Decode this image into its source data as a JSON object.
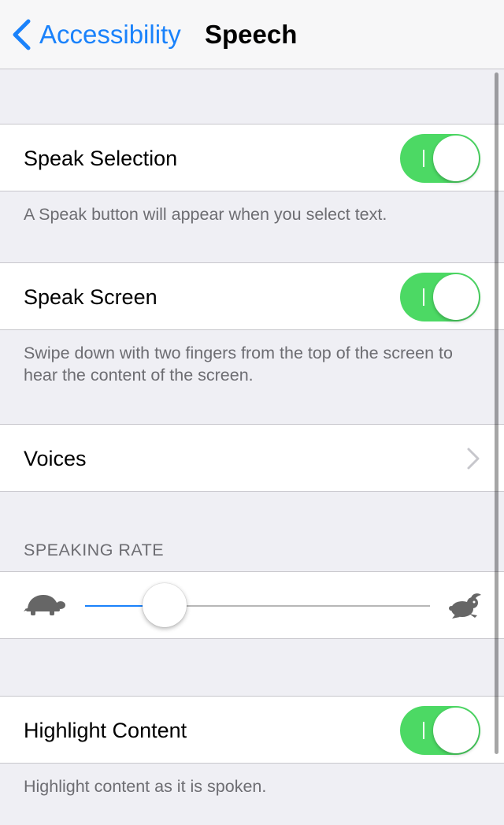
{
  "nav": {
    "back_label": "Accessibility",
    "title": "Speech"
  },
  "speak_selection": {
    "label": "Speak Selection",
    "on": true,
    "footnote": "A Speak button will appear when you select text."
  },
  "speak_screen": {
    "label": "Speak Screen",
    "on": true,
    "footnote": "Swipe down with two fingers from the top of the screen to hear the content of the screen."
  },
  "voices": {
    "label": "Voices"
  },
  "speaking_rate": {
    "header": "SPEAKING RATE",
    "value_fraction": 0.23,
    "min_icon": "turtle-icon",
    "max_icon": "rabbit-icon"
  },
  "highlight_content": {
    "label": "Highlight Content",
    "on": true,
    "footnote": "Highlight content as it is spoken."
  },
  "colors": {
    "accent": "#1a82fb",
    "toggle_on": "#4cd964",
    "background": "#efeff4"
  }
}
